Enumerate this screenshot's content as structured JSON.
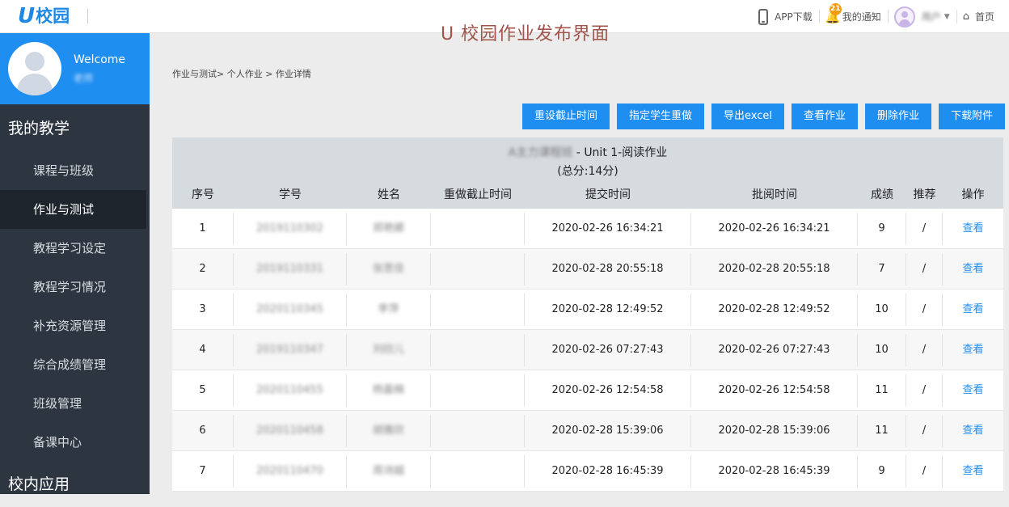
{
  "header": {
    "logo_u": "U",
    "logo_text": "校园",
    "caption": "U 校园作业发布界面",
    "app_download": "APP下载",
    "notification_badge": "21",
    "notifications": "我的通知",
    "user_name": "用户",
    "home": "首页"
  },
  "sidebar": {
    "welcome": "Welcome",
    "welcome_name": "老师",
    "section_teaching": "我的教学",
    "items": [
      {
        "label": "课程与班级"
      },
      {
        "label": "作业与测试"
      },
      {
        "label": "教程学习设定"
      },
      {
        "label": "教程学习情况"
      },
      {
        "label": "补充资源管理"
      },
      {
        "label": "综合成绩管理"
      },
      {
        "label": "班级管理"
      },
      {
        "label": "备课中心"
      }
    ],
    "section_apps": "校内应用"
  },
  "breadcrumb": "作业与测试> 个人作业 > 作业详情",
  "toolbar": {
    "reset_deadline": "重设截止时间",
    "assign_redo": "指定学生重做",
    "export_excel": "导出excel",
    "view_homework": "查看作业",
    "delete_homework": "删除作业",
    "download_attachment": "下载附件"
  },
  "homework": {
    "class_name": "A主力课程班",
    "separator": "-",
    "title": "Unit 1-阅读作业",
    "total": "(总分:14分)"
  },
  "table": {
    "headers": [
      "序号",
      "学号",
      "姓名",
      "重做截止时间",
      "提交时间",
      "批阅时间",
      "成绩",
      "推荐",
      "操作"
    ],
    "rows": [
      {
        "no": "1",
        "id": "2019110302",
        "name": "郑艳娜",
        "redo": "",
        "submit": "2020-02-26 16:34:21",
        "review": "2020-02-26 16:34:21",
        "score": "9",
        "rec": "/",
        "action": "查看"
      },
      {
        "no": "2",
        "id": "2019110331",
        "name": "张思佳",
        "redo": "",
        "submit": "2020-02-28 20:55:18",
        "review": "2020-02-28 20:55:18",
        "score": "7",
        "rec": "/",
        "action": "查看"
      },
      {
        "no": "3",
        "id": "2020110345",
        "name": "李萍",
        "redo": "",
        "submit": "2020-02-28 12:49:52",
        "review": "2020-02-28 12:49:52",
        "score": "10",
        "rec": "/",
        "action": "查看"
      },
      {
        "no": "4",
        "id": "2019110347",
        "name": "刘欣儿",
        "redo": "",
        "submit": "2020-02-26 07:27:43",
        "review": "2020-02-26 07:27:43",
        "score": "10",
        "rec": "/",
        "action": "查看"
      },
      {
        "no": "5",
        "id": "2020110455",
        "name": "杨嘉楠",
        "redo": "",
        "submit": "2020-02-26 12:54:58",
        "review": "2020-02-26 12:54:58",
        "score": "11",
        "rec": "/",
        "action": "查看"
      },
      {
        "no": "6",
        "id": "2020110458",
        "name": "胡雅欣",
        "redo": "",
        "submit": "2020-02-28 15:39:06",
        "review": "2020-02-28 15:39:06",
        "score": "11",
        "rec": "/",
        "action": "查看"
      },
      {
        "no": "7",
        "id": "2020110470",
        "name": "周诗越",
        "redo": "",
        "submit": "2020-02-28 16:45:39",
        "review": "2020-02-28 16:45:39",
        "score": "9",
        "rec": "/",
        "action": "查看"
      }
    ]
  }
}
